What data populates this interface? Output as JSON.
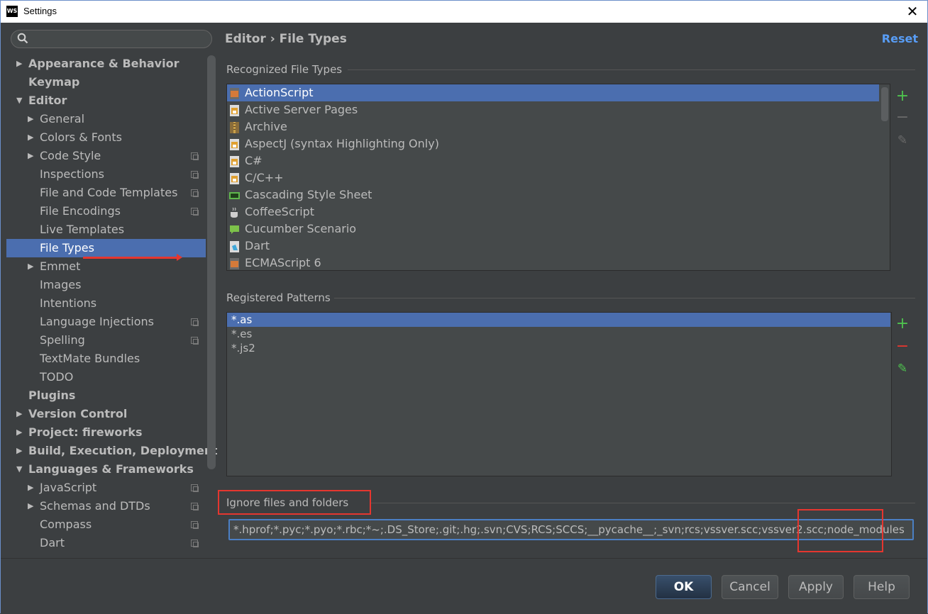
{
  "window": {
    "title": "Settings",
    "app_icon_text": "WS",
    "close_glyph": "✕"
  },
  "breadcrumb": "Editor › File Types",
  "reset_label": "Reset",
  "sidebar": {
    "search_placeholder": "",
    "items": [
      {
        "label": "Appearance & Behavior",
        "level": 0,
        "arrow": "▶",
        "bold": true
      },
      {
        "label": "Keymap",
        "level": 0,
        "arrow": "",
        "bold": true
      },
      {
        "label": "Editor",
        "level": 0,
        "arrow": "▼",
        "bold": true
      },
      {
        "label": "General",
        "level": 1,
        "arrow": "▶"
      },
      {
        "label": "Colors & Fonts",
        "level": 1,
        "arrow": "▶"
      },
      {
        "label": "Code Style",
        "level": 1,
        "arrow": "▶",
        "copy": true
      },
      {
        "label": "Inspections",
        "level": 1,
        "arrow": "",
        "copy": true
      },
      {
        "label": "File and Code Templates",
        "level": 1,
        "arrow": "",
        "copy": true
      },
      {
        "label": "File Encodings",
        "level": 1,
        "arrow": "",
        "copy": true
      },
      {
        "label": "Live Templates",
        "level": 1,
        "arrow": ""
      },
      {
        "label": "File Types",
        "level": 1,
        "arrow": "",
        "selected": true
      },
      {
        "label": "Emmet",
        "level": 1,
        "arrow": "▶"
      },
      {
        "label": "Images",
        "level": 1,
        "arrow": ""
      },
      {
        "label": "Intentions",
        "level": 1,
        "arrow": ""
      },
      {
        "label": "Language Injections",
        "level": 1,
        "arrow": "",
        "copy": true
      },
      {
        "label": "Spelling",
        "level": 1,
        "arrow": "",
        "copy": true
      },
      {
        "label": "TextMate Bundles",
        "level": 1,
        "arrow": ""
      },
      {
        "label": "TODO",
        "level": 1,
        "arrow": ""
      },
      {
        "label": "Plugins",
        "level": 0,
        "arrow": "",
        "bold": true
      },
      {
        "label": "Version Control",
        "level": 0,
        "arrow": "▶",
        "bold": true
      },
      {
        "label": "Project: fireworks",
        "level": 0,
        "arrow": "▶",
        "bold": true
      },
      {
        "label": "Build, Execution, Deployment",
        "level": 0,
        "arrow": "▶",
        "bold": true
      },
      {
        "label": "Languages & Frameworks",
        "level": 0,
        "arrow": "▼",
        "bold": true
      },
      {
        "label": "JavaScript",
        "level": 1,
        "arrow": "▶",
        "copy": true
      },
      {
        "label": "Schemas and DTDs",
        "level": 1,
        "arrow": "▶",
        "copy": true
      },
      {
        "label": "Compass",
        "level": 1,
        "arrow": "",
        "copy": true
      },
      {
        "label": "Dart",
        "level": 1,
        "arrow": "",
        "copy": true
      }
    ]
  },
  "recognized": {
    "title": "Recognized File Types",
    "items": [
      {
        "name": "ActionScript",
        "icon": "actionscript-icon",
        "color": "#d57a3a",
        "selected": true
      },
      {
        "name": "Active Server Pages",
        "icon": "file-icon",
        "color": "#e0a030"
      },
      {
        "name": "Archive",
        "icon": "archive-icon",
        "color": "#c9a04a"
      },
      {
        "name": "AspectJ (syntax Highlighting Only)",
        "icon": "file-icon",
        "color": "#e0a030"
      },
      {
        "name": "C#",
        "icon": "file-icon",
        "color": "#e0a030"
      },
      {
        "name": "C/C++",
        "icon": "file-icon",
        "color": "#e0a030"
      },
      {
        "name": "Cascading Style Sheet",
        "icon": "css-icon",
        "color": "#5fb84c"
      },
      {
        "name": "CoffeeScript",
        "icon": "coffee-icon",
        "color": "#cfcfcf"
      },
      {
        "name": "Cucumber Scenario",
        "icon": "speech-bubble-icon",
        "color": "#7dc24a"
      },
      {
        "name": "Dart",
        "icon": "dart-icon",
        "color": "#40a7d8"
      },
      {
        "name": "ECMAScript 6",
        "icon": "js-icon",
        "color": "#d57a3a"
      }
    ],
    "add_glyph": "+",
    "remove_glyph": "−",
    "edit_glyph": "✎"
  },
  "patterns": {
    "title": "Registered Patterns",
    "items": [
      {
        "value": "*.as",
        "selected": true
      },
      {
        "value": "*.es"
      },
      {
        "value": "*.js2"
      }
    ],
    "add_glyph": "+",
    "remove_glyph": "−",
    "edit_glyph": "✎"
  },
  "ignore": {
    "title": "Ignore files and folders",
    "value": "*.hprof;*.pyc;*.pyo;*.rbc;*~;.DS_Store;.git;.hg;.svn;CVS;RCS;SCCS;__pycache__;_svn;rcs;vssver.scc;vssver2.scc;node_modules"
  },
  "buttons": {
    "ok": "OK",
    "cancel": "Cancel",
    "apply": "Apply",
    "help": "Help"
  },
  "colors": {
    "accent": "#4b6eaf",
    "annotation": "#e5362f",
    "link": "#589df6",
    "add": "#4ec24e",
    "remove": "#e5362f"
  }
}
